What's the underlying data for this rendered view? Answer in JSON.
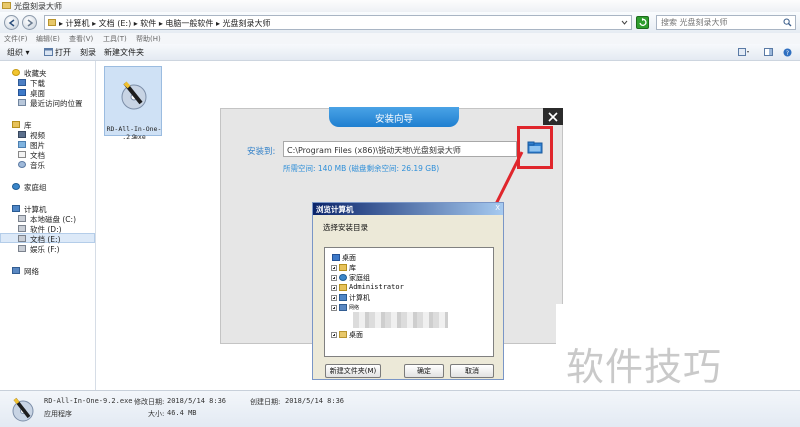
{
  "window": {
    "title": "光盘刻录大师"
  },
  "address": {
    "crumbs": "▸ 计算机 ▸ 文档 (E:) ▸ 软件 ▸ 电脑一般软件 ▸ 光盘刻录大师",
    "search_placeholder": "搜索 光盘刻录大师"
  },
  "menu": [
    "文件(F)",
    "编辑(E)",
    "查看(V)",
    "工具(T)",
    "帮助(H)"
  ],
  "toolbar": {
    "organize": "组织 ▾",
    "open": "打开",
    "burn": "刻录",
    "new_folder": "新建文件夹"
  },
  "nav": {
    "favorites": "收藏夹",
    "downloads": "下载",
    "desktop": "桌面",
    "recent": "最近访问的位置",
    "libraries": "库",
    "videos": "视频",
    "pictures": "图片",
    "documents": "文档",
    "music": "音乐",
    "homegroup": "家庭组",
    "computer": "计算机",
    "drive_c": "本地磁盘 (C:)",
    "drive_d": "软件 (D:)",
    "drive_e": "文档 (E:)",
    "drive_f": "娱乐 (F:)",
    "network": "网络"
  },
  "file": {
    "name_line1": "RD-All-In-One-9",
    "name_line2": ".2.exe"
  },
  "installer": {
    "title": "安装向导",
    "install_to_label": "安装到:",
    "path": "C:\\Program Files (x86)\\锐动天地\\光盘刻录大师",
    "space": "所需空间: 140 MB (磁盘剩余空间: 26.19 GB)"
  },
  "browse_dialog": {
    "title": "浏览计算机",
    "close": "X",
    "prompt": "选择安装目录",
    "tree": [
      "桌面",
      "库",
      "家庭组",
      "Administrator",
      "计算机",
      "网络",
      "桌面"
    ],
    "new_folder_button": "新建文件夹(M)",
    "ok_button": "确定",
    "cancel_button": "取消"
  },
  "status": {
    "filename": "RD-All-In-One-9.2.exe",
    "modified_label": "修改日期:",
    "modified": "2018/5/14 8:36",
    "created_label": "创建日期:",
    "created": "2018/5/14 8:36",
    "type": "应用程序",
    "size_label": "大小:",
    "size": "46.4 MB"
  },
  "watermark": "软件技巧",
  "colors": {
    "accent_blue": "#1f7fd0",
    "highlight_red": "#e0262c",
    "selection": "#dce9f8"
  }
}
